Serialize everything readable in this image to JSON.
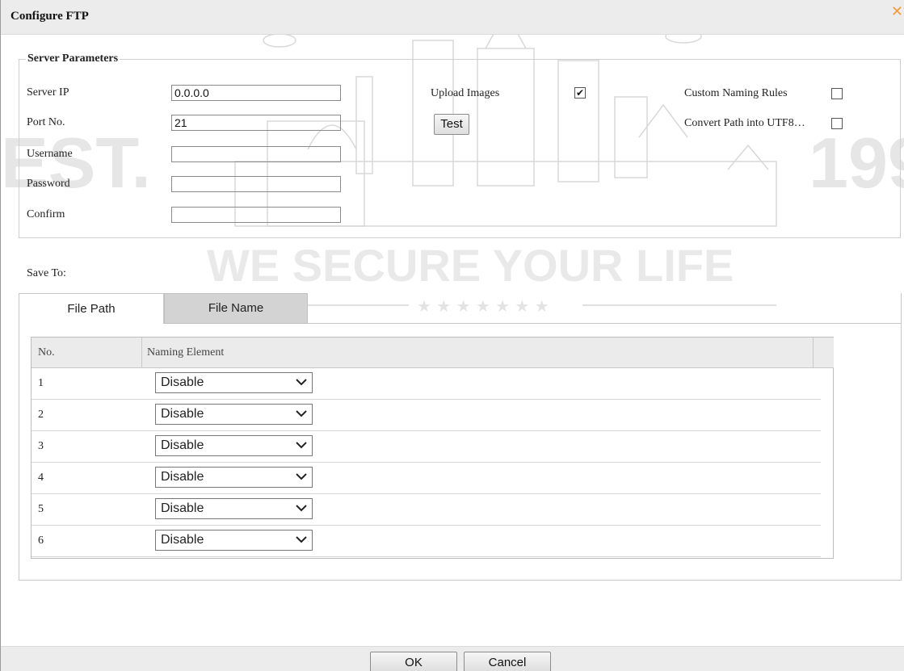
{
  "dialog": {
    "title": "Configure FTP",
    "close_icon": "close-icon"
  },
  "watermark": {
    "left_text": "EST.",
    "right_text": "199",
    "slogan": "WE SECURE YOUR LIFE"
  },
  "server": {
    "legend": "Server Parameters",
    "server_ip_label": "Server IP",
    "server_ip_value": "0.0.0.0",
    "port_label": "Port No.",
    "port_value": "21",
    "username_label": "Username",
    "username_value": "",
    "password_label": "Password",
    "password_value": "",
    "confirm_label": "Confirm",
    "confirm_value": "",
    "upload_images_label": "Upload Images",
    "upload_images_checked": true,
    "test_button": "Test",
    "custom_naming_label": "Custom Naming Rules",
    "custom_naming_checked": false,
    "convert_path_label": "Convert Path into UTF8…",
    "convert_path_checked": false
  },
  "save_to": {
    "label": "Save To:",
    "tabs": [
      {
        "label": "File Path",
        "active": true
      },
      {
        "label": "File Name",
        "active": false
      }
    ],
    "table": {
      "headers": [
        "No.",
        "Naming Element"
      ],
      "rows": [
        {
          "no": "1",
          "element": "Disable"
        },
        {
          "no": "2",
          "element": "Disable"
        },
        {
          "no": "3",
          "element": "Disable"
        },
        {
          "no": "4",
          "element": "Disable"
        },
        {
          "no": "5",
          "element": "Disable"
        },
        {
          "no": "6",
          "element": "Disable"
        }
      ]
    }
  },
  "footer": {
    "ok": "OK",
    "cancel": "Cancel"
  },
  "colors": {
    "close_accent": "#f29a3a",
    "header_bg": "#ececec"
  }
}
